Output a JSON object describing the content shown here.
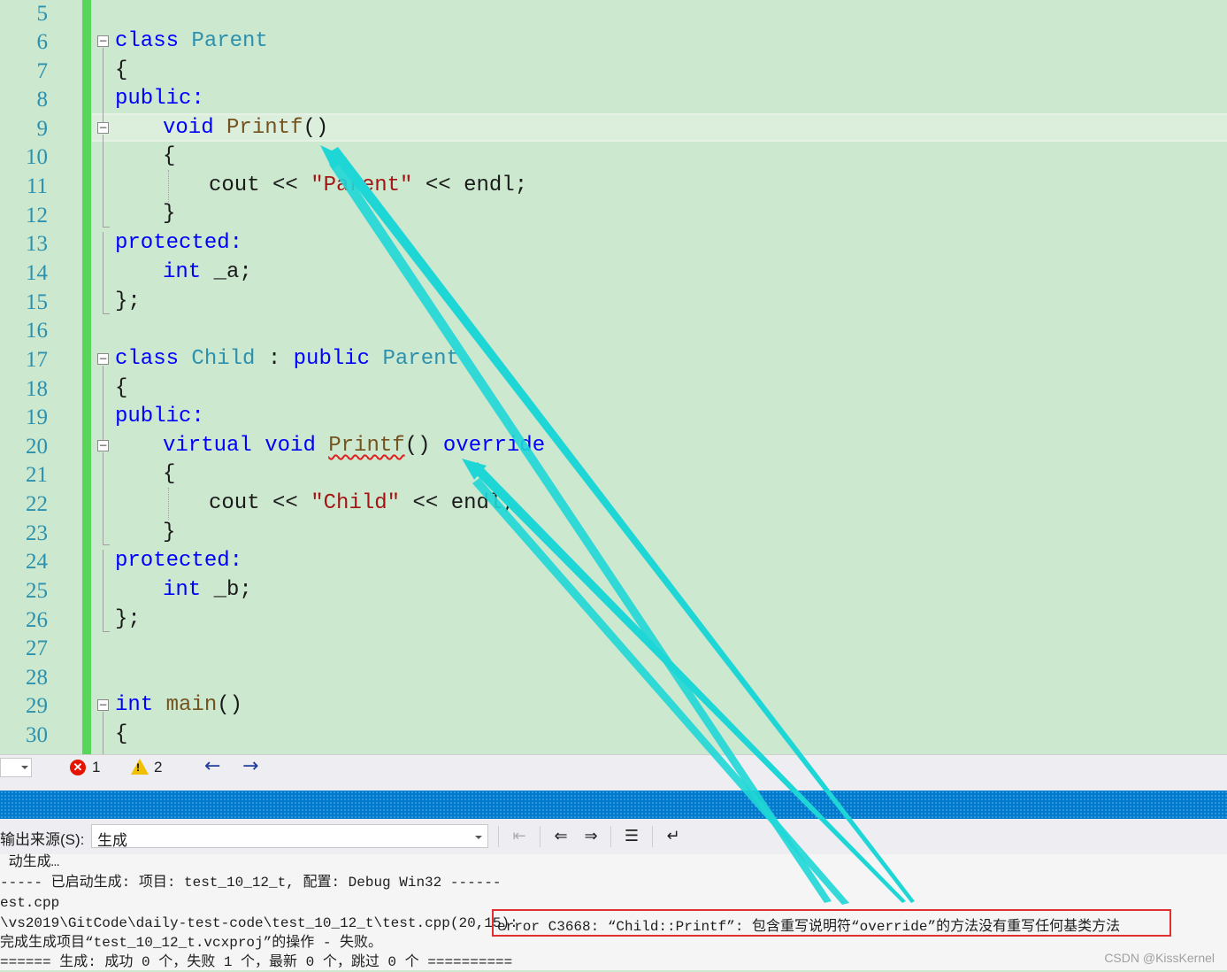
{
  "editor": {
    "line_numbers": [
      "5",
      "6",
      "7",
      "8",
      "9",
      "10",
      "11",
      "12",
      "13",
      "14",
      "15",
      "16",
      "17",
      "18",
      "19",
      "20",
      "21",
      "22",
      "23",
      "24",
      "25",
      "26",
      "27",
      "28",
      "29",
      "30"
    ],
    "code": {
      "l6_kw": "class",
      "l6_name": "Parent",
      "l7": "{",
      "l8": "public:",
      "l9_kw": "void",
      "l9_fn": "Printf",
      "l9_paren": "()",
      "l10": "{",
      "l11_a": "cout",
      "l11_op1": "<<",
      "l11_str": "\"Parent\"",
      "l11_op2": "<<",
      "l11_b": "endl;",
      "l12": "}",
      "l13": "protected:",
      "l14_kw": "int",
      "l14_var": "_a;",
      "l15": "};",
      "l17_kw": "class",
      "l17_name": "Child",
      "l17_colon": ":",
      "l17_pub": "public",
      "l17_base": "Parent",
      "l18": "{",
      "l19": "public:",
      "l20_kw1": "virtual",
      "l20_kw2": "void",
      "l20_fn": "Printf",
      "l20_paren": "()",
      "l20_ovr": "override",
      "l21": "{",
      "l22_a": "cout",
      "l22_op1": "<<",
      "l22_str": "\"Child\"",
      "l22_op2": "<<",
      "l22_b": "endl;",
      "l23": "}",
      "l24": "protected:",
      "l25_kw": "int",
      "l25_var": "_b;",
      "l26": "};",
      "l29_kw": "int",
      "l29_fn": "main",
      "l29_paren": "()",
      "l30": "{"
    }
  },
  "statusbar": {
    "error_count": "1",
    "warning_count": "2",
    "nav_back": "←",
    "nav_forward": "→"
  },
  "output": {
    "source_label": "输出来源(S):",
    "source_value": "生成",
    "lines": [
      " 动生成…",
      "----- 已启动生成: 项目: test_10_12_t, 配置: Debug Win32 ------",
      "est.cpp",
      "\\vs2019\\GitCode\\daily-test-code\\test_10_12_t\\test.cpp(20,15):",
      "完成生成项目“test_10_12_t.vcxproj”的操作 - 失败。",
      "====== 生成: 成功 0 个，失败 1 个，最新 0 个，跳过 0 个 =========="
    ],
    "error_message": "error C3668: “Child::Printf”: 包含重写说明符“override”的方法没有重写任何基类方法"
  },
  "watermark": "CSDN @KissKernel",
  "colors": {
    "editor_bg": "#cce8cf",
    "line_number": "#2b91af",
    "keyword": "#0000ff",
    "type_name": "#2b91af",
    "string": "#a31515",
    "error_highlight": "#e03030",
    "annotation_arrow": "#1fd6d6"
  }
}
